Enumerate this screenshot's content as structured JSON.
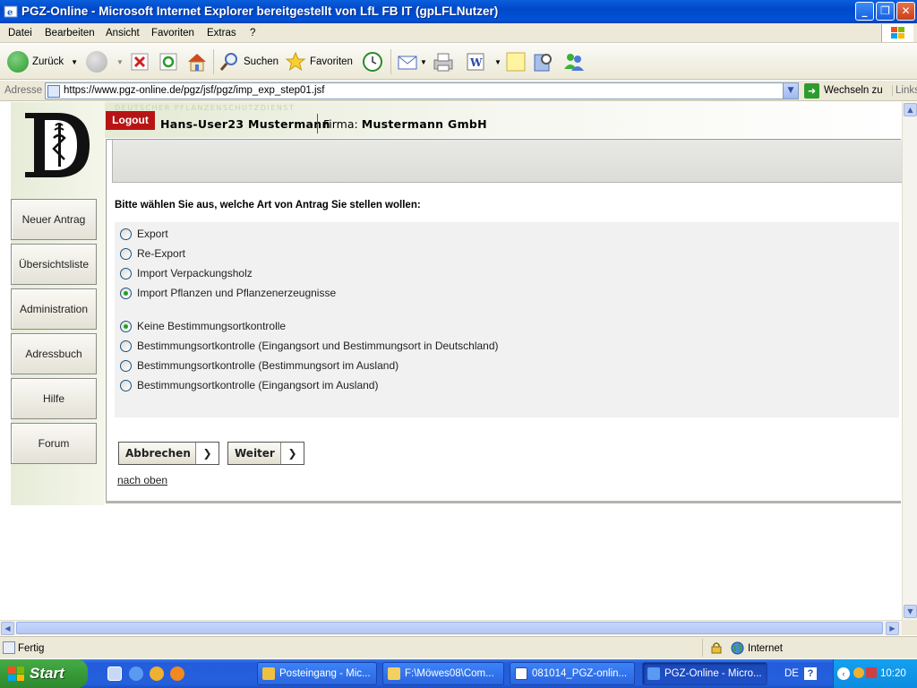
{
  "window": {
    "title": "PGZ-Online - Microsoft Internet Explorer bereitgestellt von LfL FB IT (gpLFLNutzer)"
  },
  "menu": [
    "Datei",
    "Bearbeiten",
    "Ansicht",
    "Favoriten",
    "Extras",
    "?"
  ],
  "toolbar": {
    "back": "Zurück",
    "search": "Suchen",
    "favorites": "Favoriten"
  },
  "address": {
    "label": "Adresse",
    "url": "https://www.pgz-online.de/pgz/jsf/pgz/imp_exp_step01.jsf",
    "go": "Wechseln zu",
    "links": "Links"
  },
  "page": {
    "header_small": "DEUTSCHER PFLANZENSCHUTZDIENST",
    "logout": "Logout",
    "user": "Hans-User23 Mustermann",
    "firma_label": "Firma:",
    "firma_name": "Mustermann GmbH",
    "nav": [
      "Neuer Antrag",
      "Übersichtsliste",
      "Administration",
      "Adressbuch",
      "Hilfe",
      "Forum"
    ],
    "question": "Bitte wählen Sie aus, welche Art von Antrag Sie stellen wollen:",
    "antrag_options": [
      {
        "label": "Export",
        "selected": false
      },
      {
        "label": "Re-Export",
        "selected": false
      },
      {
        "label": "Import Verpackungsholz",
        "selected": false
      },
      {
        "label": "Import Pflanzen und Pflanzenerzeugnisse",
        "selected": true
      }
    ],
    "kontrolle_options": [
      {
        "label": "Keine Bestimmungsortkontrolle",
        "selected": true
      },
      {
        "label": "Bestimmungsortkontrolle (Eingangsort und Bestimmungsort in Deutschland)",
        "selected": false
      },
      {
        "label": "Bestimmungsortkontrolle (Bestimmungsort im Ausland)",
        "selected": false
      },
      {
        "label": "Bestimmungsortkontrolle (Eingangsort im Ausland)",
        "selected": false
      }
    ],
    "cancel": "Abbrechen",
    "next": "Weiter",
    "top_link": "nach oben"
  },
  "status": {
    "text": "Fertig",
    "zone": "Internet"
  },
  "taskbar": {
    "start": "Start",
    "tasks": [
      {
        "label": "Posteingang - Mic...",
        "active": false
      },
      {
        "label": "F:\\Möwes08\\Com...",
        "active": false
      },
      {
        "label": "081014_PGZ-onlin...",
        "active": false
      },
      {
        "label": "PGZ-Online - Micro...",
        "active": true
      }
    ],
    "lang": "DE",
    "clock": "10:20"
  },
  "colors": {
    "logout_bg": "#b81414",
    "radio_selected": "#21a121",
    "taskbar": "#245ddb"
  }
}
